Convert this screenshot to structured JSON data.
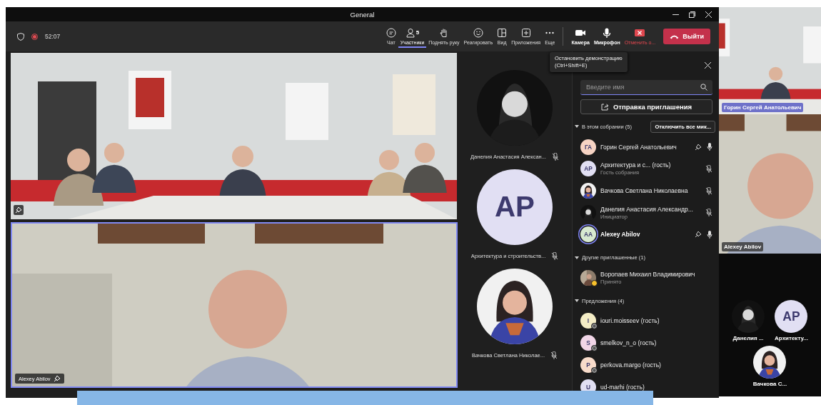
{
  "window": {
    "title": "General"
  },
  "call": {
    "duration": "52:07",
    "recording": true
  },
  "toolbar": [
    {
      "kind": "chat",
      "label": "Чат",
      "selected": false
    },
    {
      "kind": "people",
      "label": "Участники",
      "count": "5",
      "selected": true
    },
    {
      "kind": "hand",
      "label": "Поднять руку",
      "selected": false
    },
    {
      "kind": "react",
      "label": "Реагировать",
      "selected": false
    },
    {
      "kind": "view",
      "label": "Вид",
      "selected": false
    },
    {
      "kind": "apps",
      "label": "Приложения",
      "selected": false
    },
    {
      "kind": "more",
      "label": "Еще",
      "selected": false
    }
  ],
  "devices": [
    {
      "kind": "camera",
      "label": "Камера",
      "on": true
    },
    {
      "kind": "mic",
      "label": "Микрофон",
      "on": true
    },
    {
      "kind": "stop-share",
      "label": "Отменить о..."
    }
  ],
  "leave_button": {
    "label": "Выйти"
  },
  "tooltip": {
    "lines": [
      "Остановить демонстрацию",
      "(Ctrl+Shift+E)"
    ]
  },
  "stage": [
    {
      "kind": "room",
      "pinned": true,
      "highlighted": false
    },
    {
      "kind": "speaker",
      "name": "Alexey Abilov",
      "pinned": true,
      "highlighted": true
    }
  ],
  "gallery": [
    {
      "name": "Данелия Анастасия Алексан...",
      "kind": "picture",
      "muted": true
    },
    {
      "name": "Архитектура и строительств...",
      "kind": "initials",
      "initials": "AP",
      "color": "#e1dff3",
      "muted": true
    },
    {
      "name": "Вачкова Светлана Николае...",
      "kind": "picture",
      "muted": true
    }
  ],
  "participants_panel": {
    "search": {
      "placeholder": "Введите имя"
    },
    "invite_button": "Отправка приглашения",
    "sections": [
      {
        "title": "В этом собрании (5)",
        "expanded": true,
        "action": "Отключить все мик...",
        "people": [
          {
            "name": "Горин Сергей Анатольевич",
            "kind": "initials",
            "initials": "ГА",
            "color": "#f6d3c3",
            "pinned": true,
            "muted": false,
            "speaking": false
          },
          {
            "name": "Архитектура и с... (гость)",
            "subtitle": "Гость собрания",
            "kind": "initials",
            "initials": "AP",
            "color": "#e1dff3",
            "pinned": false,
            "muted": true,
            "speaking": false
          },
          {
            "name": "Вачкова Светлана Николаевна",
            "kind": "picture",
            "pinned": false,
            "muted": true,
            "speaking": false
          },
          {
            "name": "Данелия Анастасия Александр...",
            "subtitle": "Инициатор",
            "kind": "picture",
            "pinned": false,
            "muted": true,
            "speaking": false
          },
          {
            "name": "Alexey Abilov",
            "kind": "initials",
            "initials": "AA",
            "color": "#d7e9d0",
            "pinned": true,
            "muted": false,
            "speaking": true
          }
        ]
      },
      {
        "title": "Другие приглашенные (1)",
        "expanded": true,
        "people": [
          {
            "name": "Воропаев Михаил Владимирович",
            "subtitle": "Принято",
            "kind": "picture",
            "status": {
              "kind": "away"
            }
          }
        ]
      },
      {
        "title": "Предложения (4)",
        "expanded": true,
        "people": [
          {
            "name": "iouri.moisseev (гость)",
            "kind": "initials",
            "initials": "I",
            "color": "#f4edc6",
            "status": {
              "kind": "unknown"
            }
          },
          {
            "name": "smelkov_n_o (гость)",
            "kind": "initials",
            "initials": "S",
            "color": "#f1d5e7",
            "status": {
              "kind": "unknown"
            }
          },
          {
            "name": "perkova.margo (гость)",
            "kind": "initials",
            "initials": "P",
            "color": "#f8dbca",
            "status": {
              "kind": "unknown"
            }
          },
          {
            "name": "ud-marhi (гость)",
            "kind": "initials",
            "initials": "U",
            "color": "#e1dff3"
          }
        ]
      }
    ]
  },
  "side_view": {
    "videos": [
      {
        "kind": "room",
        "name": "Горин Сергей Анатольевич",
        "highlighted": true
      },
      {
        "kind": "speaker",
        "name": "Alexey Abilov",
        "highlighted": false
      }
    ],
    "tiles": [
      {
        "name": "Данелия ...",
        "kind": "picture"
      },
      {
        "name": "Архитекту...",
        "kind": "initials",
        "initials": "AP",
        "color": "#e1dff3"
      },
      {
        "name": "Вачкова С...",
        "kind": "picture"
      }
    ]
  }
}
